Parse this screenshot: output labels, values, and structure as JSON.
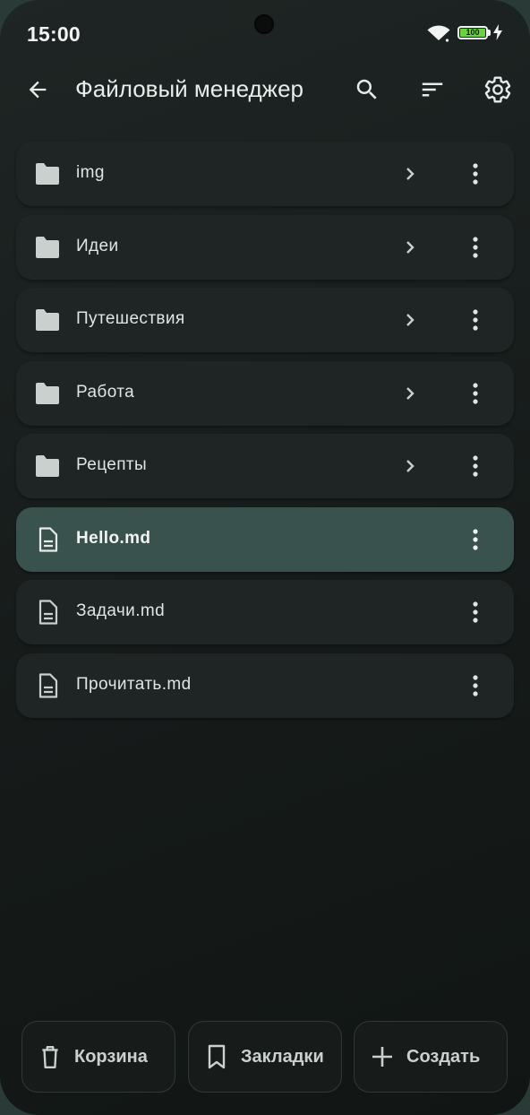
{
  "status_bar": {
    "time": "15:00",
    "battery_level": "100",
    "battery_color": "#6ad23a",
    "icons": [
      "wifi-icon",
      "battery-icon",
      "charging-bolt-icon"
    ]
  },
  "app_bar": {
    "title": "Файловый менеджер",
    "icons": [
      "back-arrow-icon",
      "search-icon",
      "sort-icon",
      "settings-gear-icon"
    ]
  },
  "files": [
    {
      "name": "img",
      "kind": "folder",
      "icon": "folder-icon"
    },
    {
      "name": "Идеи",
      "kind": "folder",
      "icon": "folder-icon"
    },
    {
      "name": "Путешествия",
      "kind": "folder",
      "icon": "folder-icon"
    },
    {
      "name": "Работа",
      "kind": "folder",
      "icon": "folder-icon"
    },
    {
      "name": "Рецепты",
      "kind": "folder",
      "icon": "folder-icon"
    },
    {
      "name": "Hello.md",
      "kind": "file",
      "icon": "document-icon",
      "selected": true
    },
    {
      "name": "Задачи.md",
      "kind": "file",
      "icon": "document-icon"
    },
    {
      "name": "Прочитать.md",
      "kind": "file",
      "icon": "document-icon"
    }
  ],
  "bottom_bar": {
    "trash_label": "Корзина",
    "bookmarks_label": "Закладки",
    "create_label": "Создать"
  },
  "colors": {
    "row_background": "#1f2524",
    "selected_row_background": "#3a524d",
    "accent": "#6ad23a"
  }
}
